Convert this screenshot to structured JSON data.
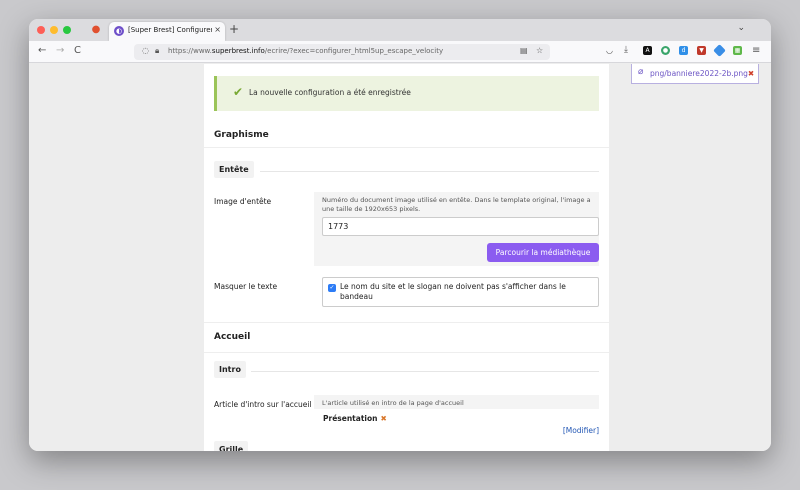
{
  "browser": {
    "tab_title": "[Super Brest] Configurer le squel",
    "tab_close": "×",
    "new_tab": "+",
    "tab_list": "⌄",
    "url_prefix": "https://www.",
    "url_domain": "superbrest.info",
    "url_rest": "/ecrire/?exec=configurer_html5up_escape_velocity",
    "back": "←",
    "forward": "→",
    "reload": "C"
  },
  "alert": {
    "text": "La nouvelle configuration a été enregistrée"
  },
  "graphisme": {
    "title": "Graphisme",
    "subtab": "Entête",
    "image_label": "Image d'entête",
    "image_explain": "Numéro du document image utilisé en entête. Dans le template original, l'image a une taille de 1920x653 pixels.",
    "image_value": "1773",
    "browse_button": "Parcourir la médiathèque",
    "hide_label": "Masquer le texte",
    "hide_checkbox_label": "Le nom du site et le slogan ne doivent pas s'afficher dans le bandeau"
  },
  "accueil": {
    "title": "Accueil",
    "subtab": "Intro",
    "intro_label": "Article d'intro sur l'accueil",
    "intro_hint": "L'article utilisé en intro de la page d'accueil",
    "intro_article": "Présentation",
    "modify_link": "[Modifier]",
    "next_subtab": "Grille"
  },
  "sidebar": {
    "file_name": "png/banniere2022-2b.png"
  },
  "colors": {
    "accent": "#8b5cf0",
    "success_border": "#9bc458",
    "link": "#2458b5"
  }
}
